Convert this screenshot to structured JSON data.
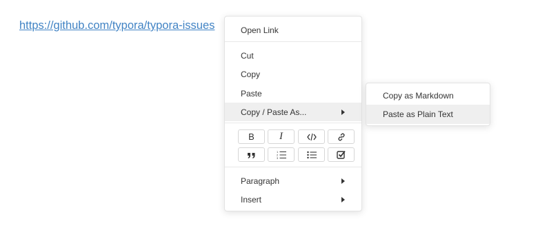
{
  "document": {
    "link_text": "https://github.com/typora/typora-issues"
  },
  "context_menu": {
    "open_link": "Open Link",
    "cut": "Cut",
    "copy": "Copy",
    "paste": "Paste",
    "copy_paste_as": "Copy / Paste As...",
    "format_buttons": {
      "bold": "B",
      "italic": "I"
    },
    "paragraph": "Paragraph",
    "insert": "Insert"
  },
  "submenu": {
    "copy_as_markdown": "Copy as Markdown",
    "paste_as_plain_text": "Paste as Plain Text"
  },
  "colors": {
    "link": "#4183c4",
    "hover_background": "#efefef",
    "menu_border": "#e3e3e3"
  }
}
